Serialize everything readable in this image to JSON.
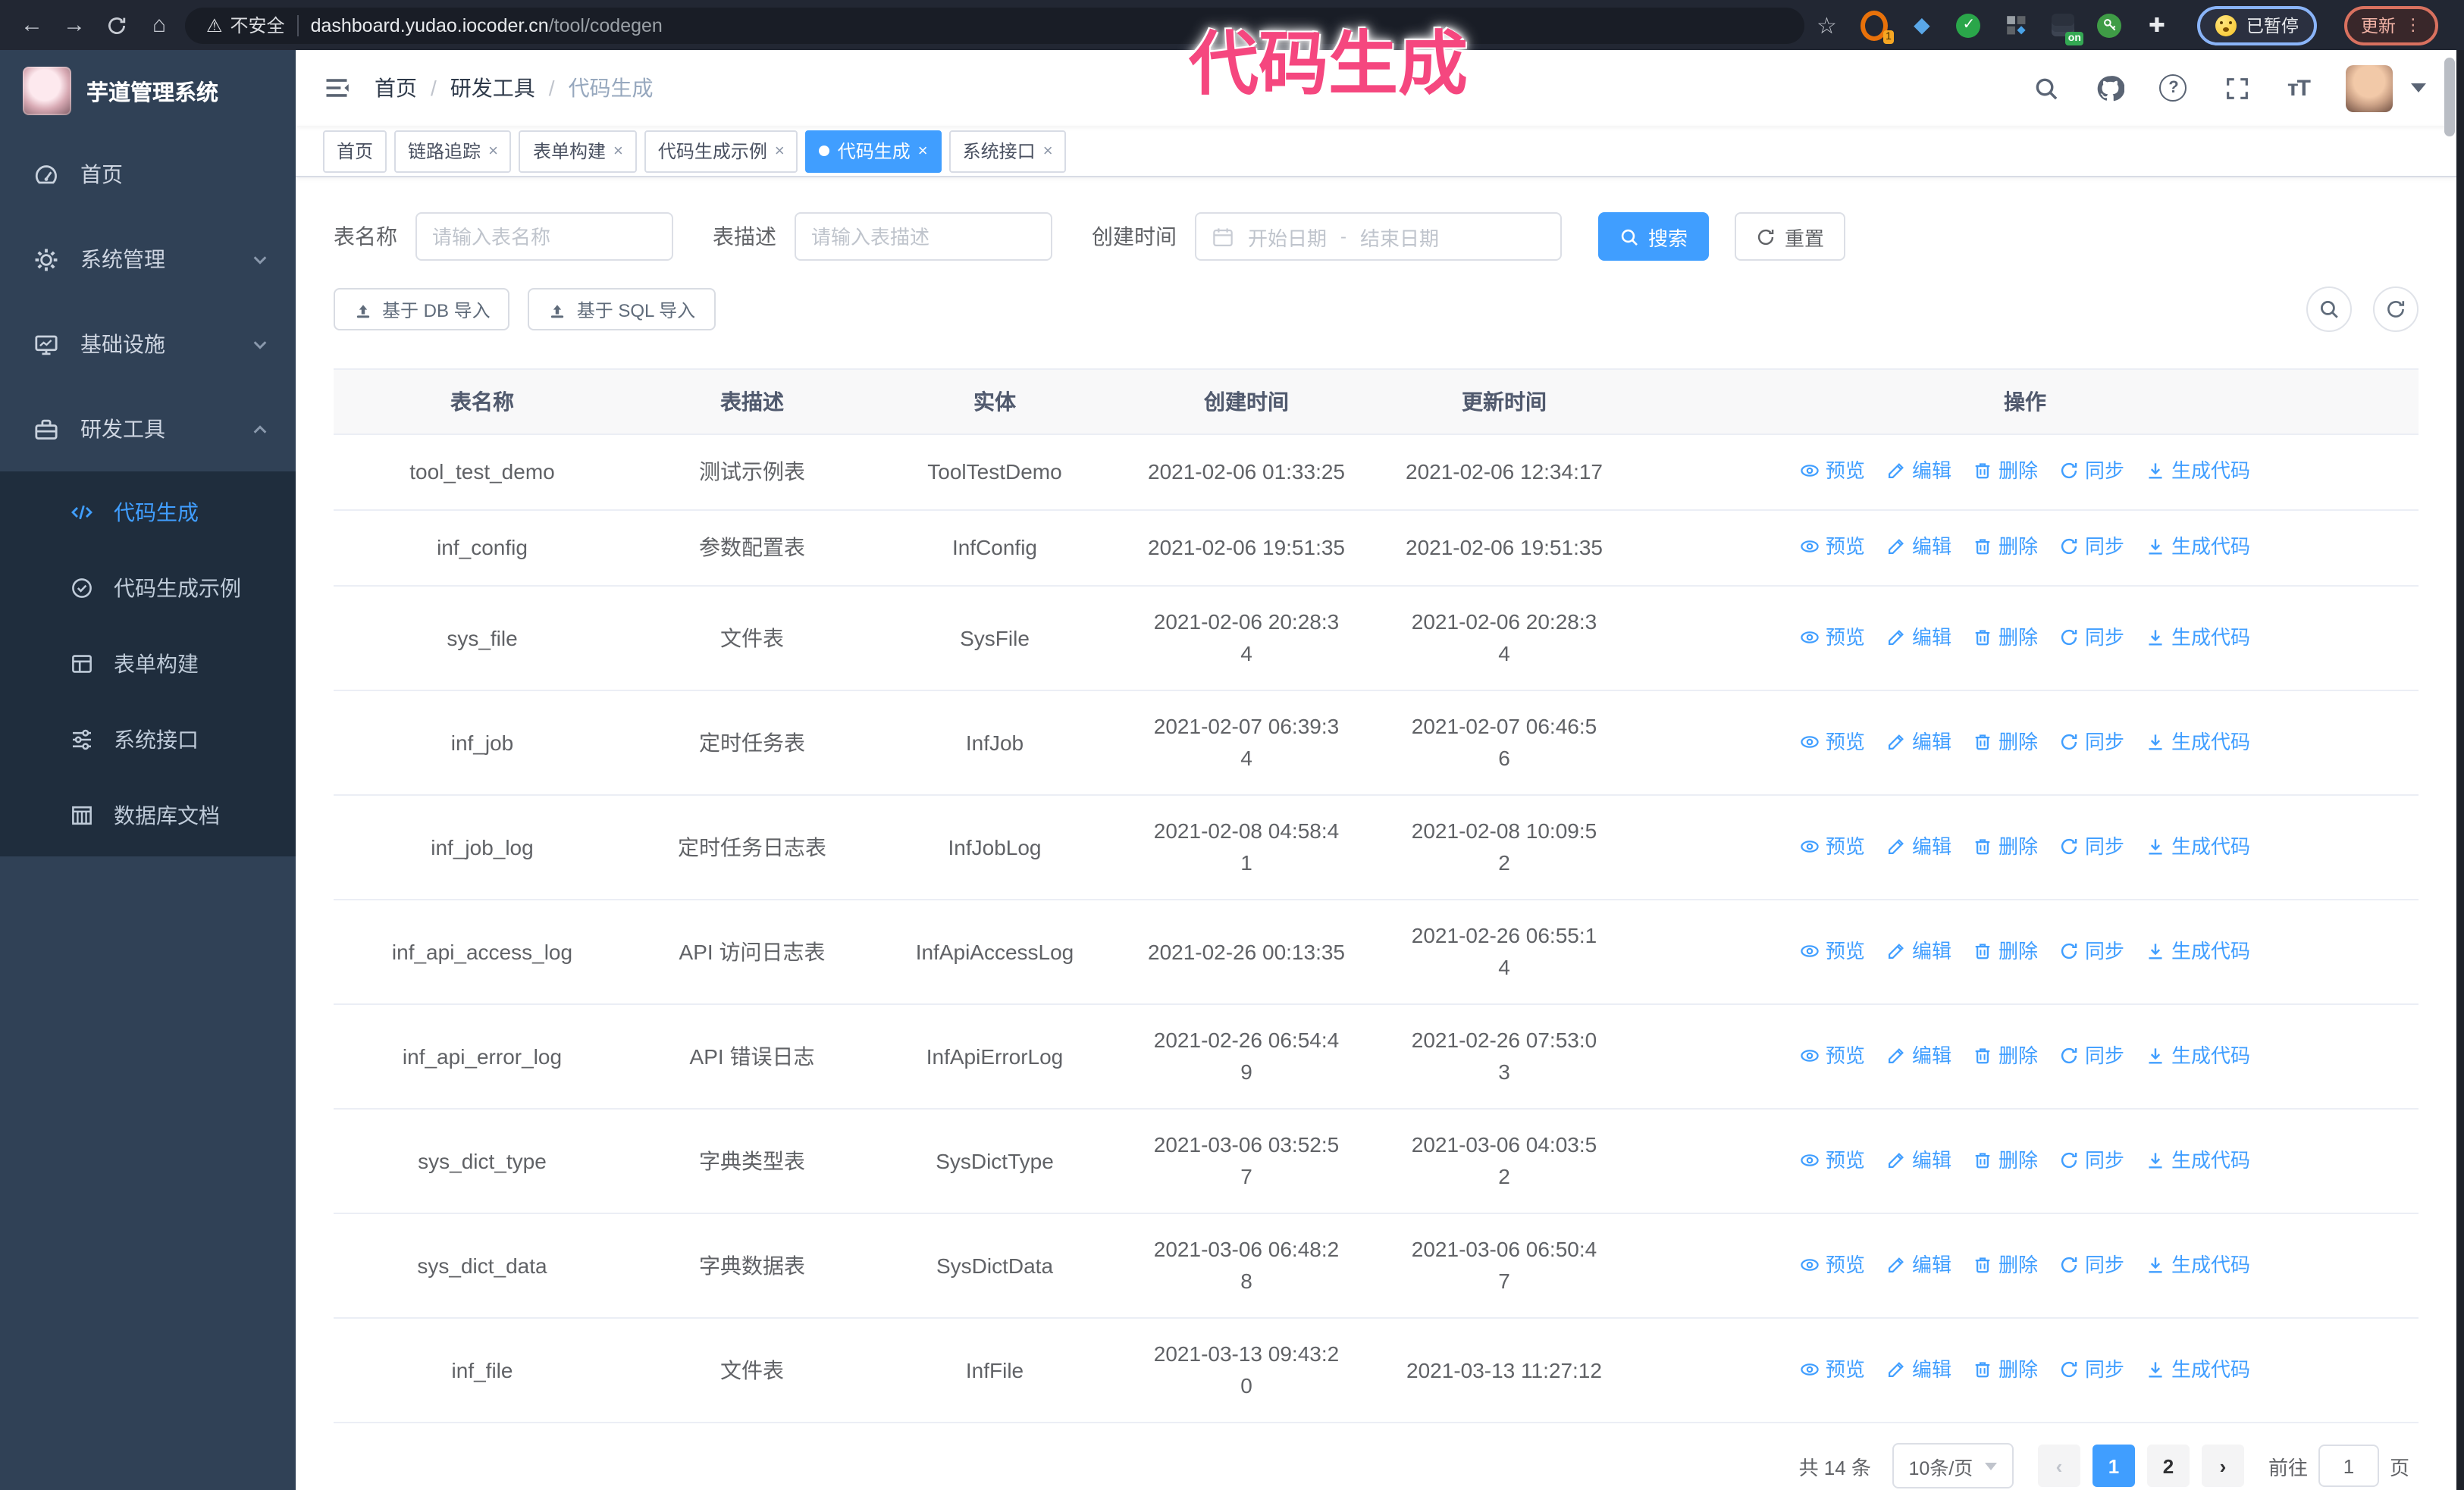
{
  "browser": {
    "security_label": "不安全",
    "url_host": "dashboard.yudao.iocoder.cn",
    "url_path": "/tool/codegen",
    "ext_badge_count": "1",
    "ext_on_badge": "on",
    "paused_label": "已暂停",
    "update_label": "更新",
    "menu_dots": "⋮"
  },
  "annotation": {
    "text": "代码生成",
    "color": "#f5477f"
  },
  "sidebar": {
    "app_title": "芋道管理系统",
    "items": [
      {
        "label": "首页",
        "icon": "dashboard-icon"
      },
      {
        "label": "系统管理",
        "icon": "gear-icon"
      },
      {
        "label": "基础设施",
        "icon": "monitor-icon"
      },
      {
        "label": "研发工具",
        "icon": "toolbox-icon"
      }
    ],
    "submenu": [
      {
        "label": "代码生成",
        "icon": "code-icon",
        "active": true
      },
      {
        "label": "代码生成示例",
        "icon": "badge-icon"
      },
      {
        "label": "表单构建",
        "icon": "form-icon"
      },
      {
        "label": "系统接口",
        "icon": "sliders-icon"
      },
      {
        "label": "数据库文档",
        "icon": "database-icon"
      }
    ]
  },
  "header": {
    "breadcrumb": [
      "首页",
      "研发工具",
      "代码生成"
    ],
    "separator": "/"
  },
  "tags": [
    {
      "label": "首页"
    },
    {
      "label": "链路追踪"
    },
    {
      "label": "表单构建"
    },
    {
      "label": "代码生成示例"
    },
    {
      "label": "代码生成"
    },
    {
      "label": "系统接口"
    }
  ],
  "close_glyph": "×",
  "filters": {
    "name_label": "表名称",
    "name_placeholder": "请输入表名称",
    "desc_label": "表描述",
    "desc_placeholder": "请输入表描述",
    "time_label": "创建时间",
    "start_placeholder": "开始日期",
    "range_separator": "-",
    "end_placeholder": "结束日期",
    "search_label": "搜索",
    "reset_label": "重置"
  },
  "toolbar": {
    "import_db_label": "基于 DB 导入",
    "import_sql_label": "基于 SQL 导入"
  },
  "table": {
    "columns": [
      "表名称",
      "表描述",
      "实体",
      "创建时间",
      "更新时间",
      "操作"
    ],
    "actions": [
      {
        "label": "预览",
        "icon": "eye-icon"
      },
      {
        "label": "编辑",
        "icon": "edit-icon"
      },
      {
        "label": "删除",
        "icon": "delete-icon"
      },
      {
        "label": "同步",
        "icon": "sync-icon"
      },
      {
        "label": "生成代码",
        "icon": "download-icon"
      }
    ],
    "rows": [
      {
        "name": "tool_test_demo",
        "desc": "测试示例表",
        "entity": "ToolTestDemo",
        "created": "2021-02-06 01:33:25",
        "updated": "2021-02-06 12:34:17"
      },
      {
        "name": "inf_config",
        "desc": "参数配置表",
        "entity": "InfConfig",
        "created": "2021-02-06 19:51:35",
        "updated": "2021-02-06 19:51:35"
      },
      {
        "name": "sys_file",
        "desc": "文件表",
        "entity": "SysFile",
        "created": "2021-02-06 20:28:3\n4",
        "updated": "2021-02-06 20:28:3\n4"
      },
      {
        "name": "inf_job",
        "desc": "定时任务表",
        "entity": "InfJob",
        "created": "2021-02-07 06:39:3\n4",
        "updated": "2021-02-07 06:46:5\n6"
      },
      {
        "name": "inf_job_log",
        "desc": "定时任务日志表",
        "entity": "InfJobLog",
        "created": "2021-02-08 04:58:4\n1",
        "updated": "2021-02-08 10:09:5\n2"
      },
      {
        "name": "inf_api_access_log",
        "desc": "API 访问日志表",
        "entity": "InfApiAccessLog",
        "created": "2021-02-26 00:13:35",
        "updated": "2021-02-26 06:55:1\n4"
      },
      {
        "name": "inf_api_error_log",
        "desc": "API 错误日志",
        "entity": "InfApiErrorLog",
        "created": "2021-02-26 06:54:4\n9",
        "updated": "2021-02-26 07:53:0\n3"
      },
      {
        "name": "sys_dict_type",
        "desc": "字典类型表",
        "entity": "SysDictType",
        "created": "2021-03-06 03:52:5\n7",
        "updated": "2021-03-06 04:03:5\n2"
      },
      {
        "name": "sys_dict_data",
        "desc": "字典数据表",
        "entity": "SysDictData",
        "created": "2021-03-06 06:48:2\n8",
        "updated": "2021-03-06 06:50:4\n7"
      },
      {
        "name": "inf_file",
        "desc": "文件表",
        "entity": "InfFile",
        "created": "2021-03-13 09:43:2\n0",
        "updated": "2021-03-13 11:27:12"
      }
    ]
  },
  "pagination": {
    "total_label": "共 14 条",
    "page_size": "10条/页",
    "prev_glyph": "‹",
    "next_glyph": "›",
    "pages": [
      "1",
      "2"
    ],
    "active_page": "1",
    "goto_label": "前往",
    "goto_value": "1",
    "page_suffix": "页"
  },
  "colors": {
    "primary": "#409eff",
    "sidebar": "#304156",
    "submenu": "#1f2d3d",
    "annotation": "#f5477f"
  }
}
